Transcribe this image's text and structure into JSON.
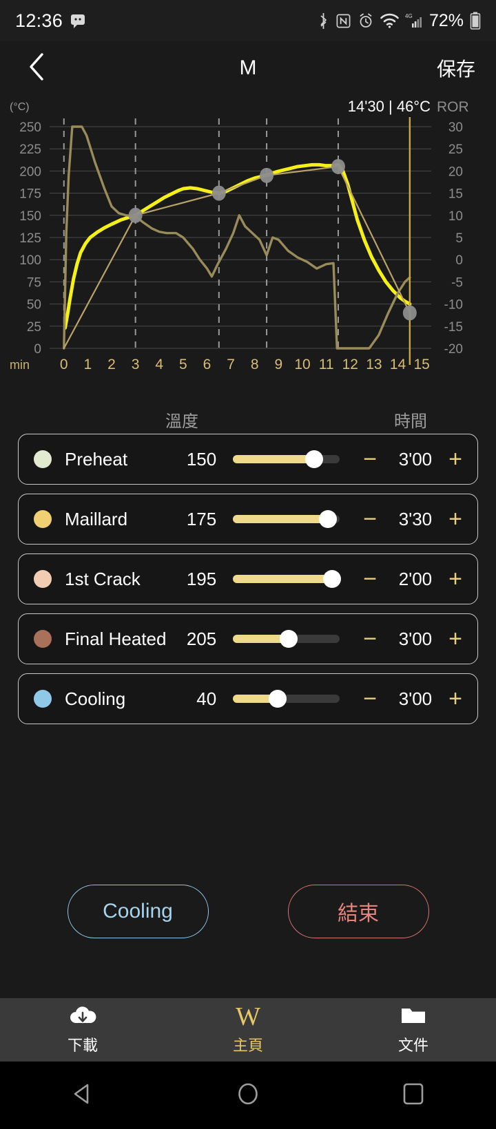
{
  "statusbar": {
    "time": "12:36",
    "battery_text": "72%",
    "network": "4G",
    "icons": [
      "message-icon",
      "bluetooth-icon",
      "nfc-icon",
      "alarm-icon",
      "wifi-icon",
      "cellular-signal-icon",
      "battery-icon"
    ]
  },
  "header": {
    "back_icon": "chevron-left-icon",
    "title": "M",
    "save_label": "保存"
  },
  "chart_data": {
    "type": "line",
    "title": "",
    "ylabel": "(°C)",
    "ylabel_right": "ROR",
    "xlabel": "min",
    "readout": "14'30 | 46°C",
    "ylim": [
      0,
      250
    ],
    "ylim_right": [
      -20,
      30
    ],
    "xlim": [
      -0.6,
      15.4
    ],
    "yticks": [
      0,
      25,
      50,
      75,
      100,
      125,
      150,
      175,
      200,
      225,
      250
    ],
    "yticks_right": [
      -20,
      -15,
      -10,
      -5,
      0,
      5,
      10,
      15,
      20,
      25,
      30
    ],
    "xticks": [
      0,
      1,
      2,
      3,
      4,
      5,
      6,
      7,
      8,
      9,
      10,
      11,
      12,
      13,
      14,
      15
    ],
    "grid": true,
    "legend": "none",
    "cursor_time": 14.5,
    "phase_markers": [
      {
        "x": 3.0,
        "y": 150
      },
      {
        "x": 6.5,
        "y": 175
      },
      {
        "x": 8.5,
        "y": 195
      },
      {
        "x": 11.5,
        "y": 205
      },
      {
        "x": 14.5,
        "y": 40
      }
    ],
    "series": [
      {
        "name": "bean-temperature",
        "color": "#f5f018",
        "axis": "left",
        "points": [
          [
            0.05,
            23
          ],
          [
            0.15,
            38
          ],
          [
            0.25,
            55
          ],
          [
            0.4,
            78
          ],
          [
            0.55,
            95
          ],
          [
            0.7,
            108
          ],
          [
            0.9,
            118
          ],
          [
            1.1,
            125
          ],
          [
            1.4,
            131
          ],
          [
            1.7,
            136
          ],
          [
            2.0,
            140
          ],
          [
            2.4,
            145
          ],
          [
            2.75,
            148
          ],
          [
            3.0,
            150
          ],
          [
            3.3,
            155
          ],
          [
            3.6,
            160
          ],
          [
            3.9,
            165
          ],
          [
            4.2,
            170
          ],
          [
            4.5,
            174
          ],
          [
            4.8,
            178
          ],
          [
            5.0,
            180
          ],
          [
            5.3,
            181
          ],
          [
            5.6,
            180
          ],
          [
            5.9,
            178
          ],
          [
            6.2,
            176
          ],
          [
            6.5,
            175
          ],
          [
            6.8,
            177
          ],
          [
            7.1,
            181
          ],
          [
            7.4,
            185
          ],
          [
            7.7,
            189
          ],
          [
            8.0,
            192
          ],
          [
            8.3,
            194
          ],
          [
            8.6,
            196
          ],
          [
            8.9,
            199
          ],
          [
            9.2,
            201
          ],
          [
            9.5,
            203
          ],
          [
            9.8,
            205
          ],
          [
            10.1,
            206
          ],
          [
            10.4,
            207
          ],
          [
            10.7,
            207
          ],
          [
            11.0,
            206
          ],
          [
            11.3,
            206
          ],
          [
            11.5,
            207
          ],
          [
            11.7,
            200
          ],
          [
            11.9,
            185
          ],
          [
            12.1,
            165
          ],
          [
            12.3,
            145
          ],
          [
            12.6,
            122
          ],
          [
            12.9,
            103
          ],
          [
            13.2,
            88
          ],
          [
            13.5,
            75
          ],
          [
            13.8,
            65
          ],
          [
            14.1,
            57
          ],
          [
            14.3,
            53
          ],
          [
            14.5,
            50
          ]
        ]
      },
      {
        "name": "ror-curve",
        "color": "#9a8c5a",
        "axis": "right",
        "points": [
          [
            0.0,
            -20
          ],
          [
            0.1,
            6
          ],
          [
            0.2,
            19
          ],
          [
            0.35,
            30
          ],
          [
            0.75,
            30
          ],
          [
            0.95,
            28
          ],
          [
            1.3,
            22
          ],
          [
            1.7,
            16
          ],
          [
            2.0,
            12
          ],
          [
            2.3,
            10.5
          ],
          [
            2.6,
            10
          ],
          [
            3.0,
            9.8
          ],
          [
            3.3,
            8.5
          ],
          [
            3.7,
            7
          ],
          [
            4.0,
            6.3
          ],
          [
            4.3,
            6.0
          ],
          [
            4.7,
            6.0
          ],
          [
            5.0,
            5.0
          ],
          [
            5.4,
            2.5
          ],
          [
            5.7,
            0
          ],
          [
            6.0,
            -2.0
          ],
          [
            6.2,
            -3.8
          ],
          [
            6.45,
            -1.0
          ],
          [
            6.8,
            2.5
          ],
          [
            7.1,
            6.0
          ],
          [
            7.35,
            10.0
          ],
          [
            7.6,
            7.5
          ],
          [
            7.9,
            6.0
          ],
          [
            8.2,
            4.5
          ],
          [
            8.5,
            1.0
          ],
          [
            8.75,
            5.0
          ],
          [
            9.0,
            4.5
          ],
          [
            9.4,
            2.0
          ],
          [
            9.8,
            0.5
          ],
          [
            10.2,
            -0.5
          ],
          [
            10.6,
            -2.0
          ],
          [
            11.0,
            -1.0
          ],
          [
            11.3,
            -0.8
          ],
          [
            11.45,
            -20
          ],
          [
            12.8,
            -20
          ],
          [
            13.2,
            -17
          ],
          [
            13.6,
            -12
          ],
          [
            14.0,
            -7.5
          ],
          [
            14.3,
            -5.0
          ],
          [
            14.5,
            -4.0
          ]
        ]
      },
      {
        "name": "target-profile",
        "color": "#b9a369",
        "axis": "left",
        "points": [
          [
            0.0,
            0
          ],
          [
            3.0,
            150
          ],
          [
            6.5,
            175
          ],
          [
            8.5,
            195
          ],
          [
            11.5,
            205
          ],
          [
            14.5,
            40
          ]
        ]
      }
    ]
  },
  "table": {
    "header_temp": "溫度",
    "header_time": "時間",
    "minus_label": "−",
    "plus_label": "+",
    "rows": [
      {
        "name": "Preheat",
        "dot_color": "#e2ead0",
        "temp": "150",
        "slider_pct": 76,
        "time": "3'00"
      },
      {
        "name": "Maillard",
        "dot_color": "#f0d070",
        "temp": "175",
        "slider_pct": 89,
        "time": "3'30"
      },
      {
        "name": "1st Crack",
        "dot_color": "#f1cdb4",
        "temp": "195",
        "slider_pct": 93,
        "time": "2'00"
      },
      {
        "name": "Final Heated",
        "dot_color": "#a9705a",
        "temp": "205",
        "slider_pct": 52,
        "time": "3'00"
      },
      {
        "name": "Cooling",
        "dot_color": "#90c9e8",
        "temp": "40",
        "slider_pct": 42,
        "time": "3'00"
      }
    ]
  },
  "actions": {
    "cooling_label": "Cooling",
    "end_label": "結束",
    "cooling_color": "#8fc9e8",
    "end_color": "#d9776f"
  },
  "bottom_nav": {
    "items": [
      {
        "label": "下載",
        "icon": "cloud-download-icon",
        "active": false
      },
      {
        "label": "主頁",
        "icon": "w-logo-icon",
        "active": true
      },
      {
        "label": "文件",
        "icon": "folder-icon",
        "active": false
      }
    ],
    "home_logo": "W"
  },
  "android_nav": {
    "back": "triangle-back-icon",
    "home": "circle-home-icon",
    "recents": "square-recents-icon"
  }
}
